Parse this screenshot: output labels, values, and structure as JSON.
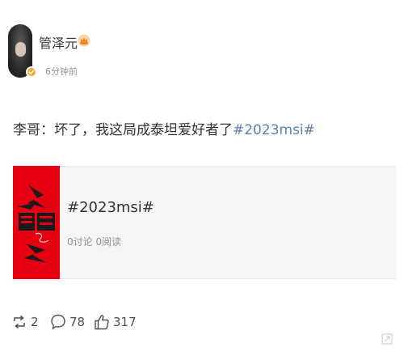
{
  "post": {
    "author": {
      "name": "管泽元",
      "crown_icon": "crown-icon",
      "verified_badge_icon": "verified-badge-icon"
    },
    "timestamp": "6分钟前",
    "text": {
      "body": "李哥：坏了，我这局成泰坦爱好者了",
      "hashtag": "#2023msi#"
    },
    "card": {
      "title": "#2023msi#",
      "discussions": "0讨论",
      "reads": "0阅读",
      "thumbnail_icon": "msi-event-thumbnail"
    },
    "actions": {
      "repost_count": "2",
      "comment_count": "78",
      "like_count": "317"
    }
  },
  "colors": {
    "link": "#5b7fb1",
    "thumbnail_bg": "#e60012",
    "badge": "#f5a623",
    "muted_text": "#939393"
  }
}
